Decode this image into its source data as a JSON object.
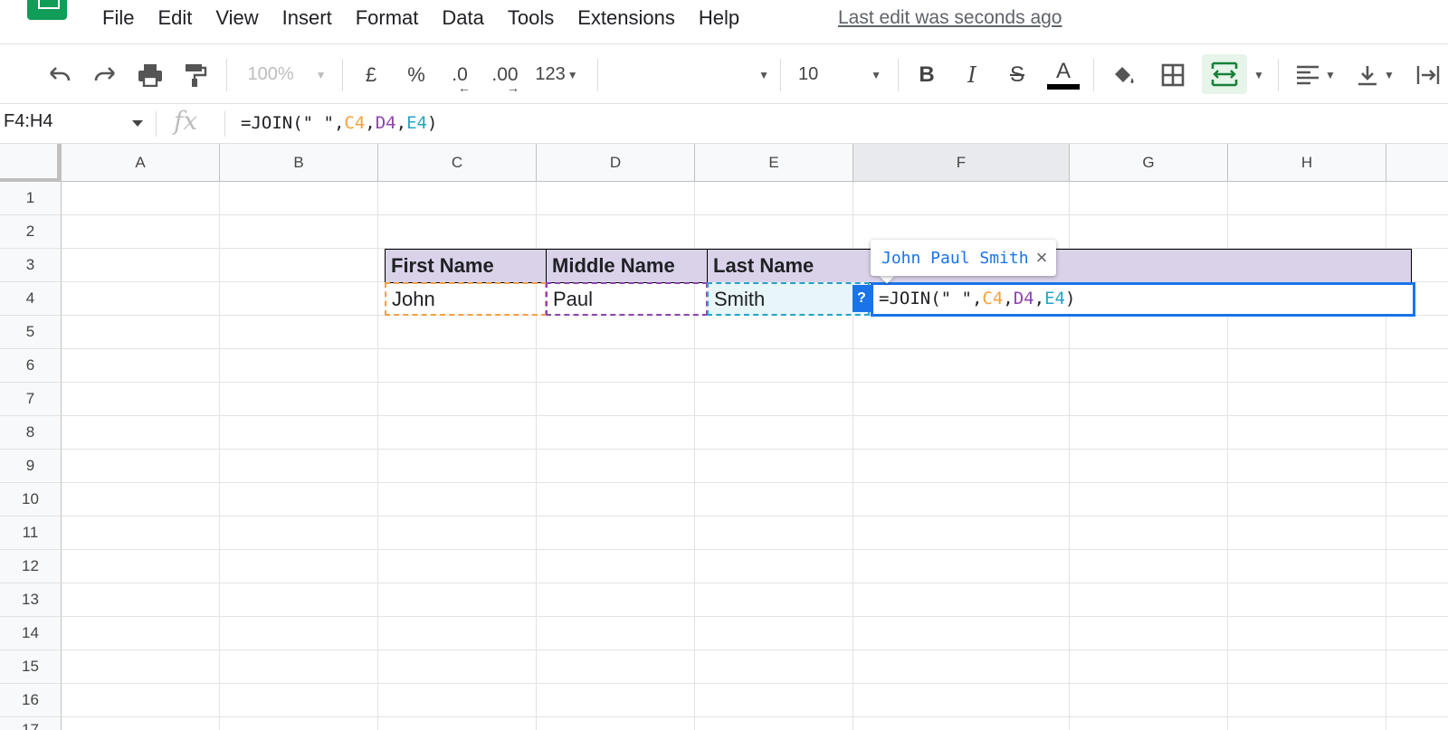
{
  "menu": {
    "items": [
      "File",
      "Edit",
      "View",
      "Insert",
      "Format",
      "Data",
      "Tools",
      "Extensions",
      "Help"
    ],
    "last_edit": "Last edit was seconds ago"
  },
  "toolbar": {
    "zoom": "100%",
    "currency": "£",
    "percent": "%",
    "decrease_decimals": ".0",
    "increase_decimals": ".00",
    "number_format": "123",
    "font_size": "10",
    "bold": "B",
    "italic": "I",
    "strike": "S",
    "text_color": "A"
  },
  "formula_bar": {
    "name_box": "F4:H4",
    "fx": "fx",
    "formula_prefix": "=JOIN(\" \",",
    "ref1": "C4",
    "comma1": ",",
    "ref2": "D4",
    "comma2": ",",
    "ref3": "E4",
    "suffix": ")"
  },
  "grid": {
    "columns": [
      "A",
      "B",
      "C",
      "D",
      "E",
      "F",
      "G",
      "H"
    ],
    "rows": [
      "1",
      "2",
      "3",
      "4",
      "5",
      "6",
      "7",
      "8",
      "9",
      "10",
      "11",
      "12",
      "13",
      "14",
      "15",
      "16",
      "17"
    ],
    "cells": {
      "C3": "First Name",
      "D3": "Middle Name",
      "E3": "Last Name",
      "C4": "John",
      "D4": "Paul",
      "E4": "Smith"
    },
    "help_badge": "?",
    "preview_result": "John Paul Smith",
    "preview_close": "×"
  },
  "colors": {
    "header_fill": "#d9d2e9",
    "ref1": "#f4a03f",
    "ref2": "#8e44ad",
    "ref3": "#27a3c6",
    "selection": "#1a73e8"
  }
}
